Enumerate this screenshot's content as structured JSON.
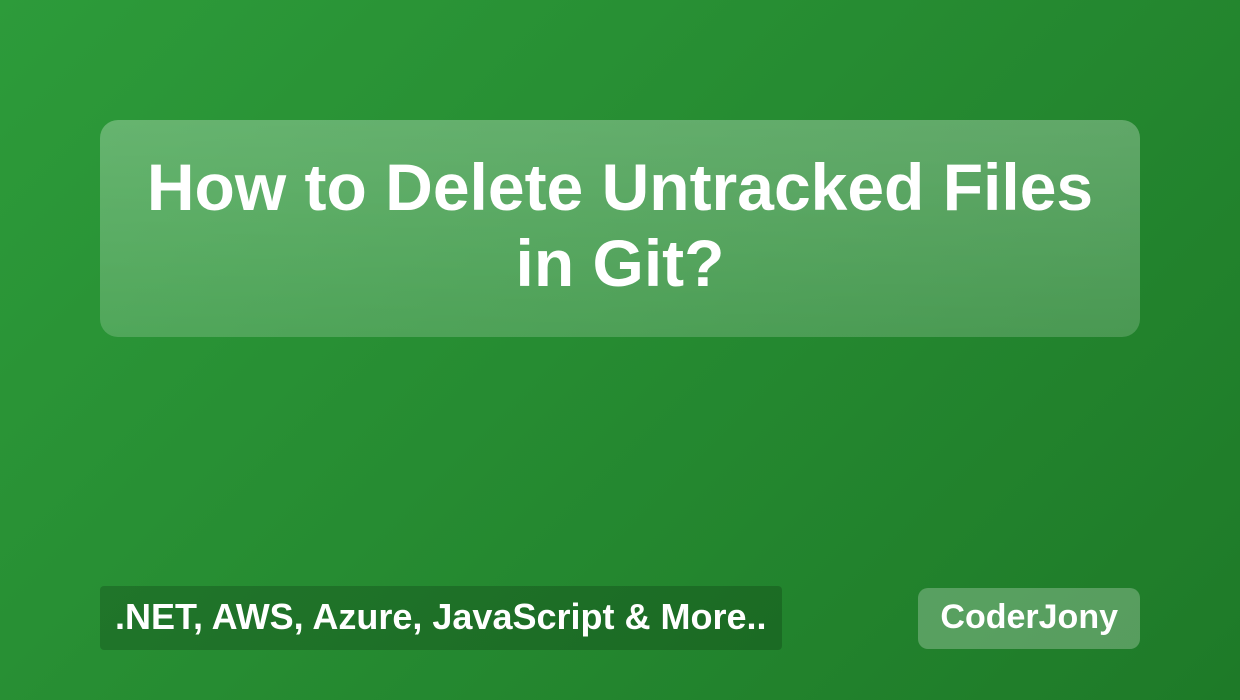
{
  "title": "How to Delete Untracked Files in Git?",
  "topics": ".NET, AWS, Azure, JavaScript & More..",
  "brand": "CoderJony"
}
